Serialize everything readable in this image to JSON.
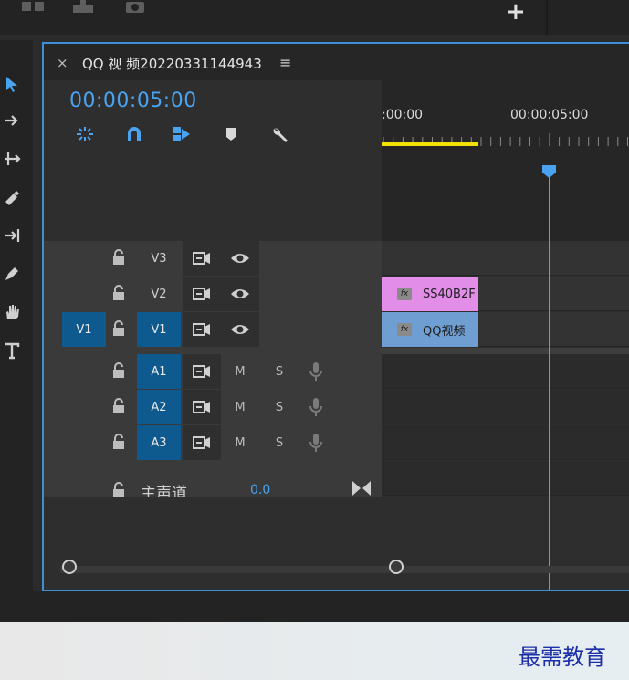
{
  "colors": {
    "accent": "#4aa3f0",
    "selected_track": "#0e5a8e",
    "panel_border": "#3f8fd6",
    "work_area": "#f0e000",
    "clip_graphic": "#e28ee8",
    "clip_video": "#6f9fd2",
    "watermark": "#1c2ea8"
  },
  "topbar": {
    "icons": [
      "grid-icon",
      "export-icon",
      "camera-icon"
    ],
    "add_label": "+"
  },
  "tools": [
    "selection-tool-icon",
    "track-select-tool-icon",
    "ripple-edit-tool-icon",
    "razor-tool-icon",
    "slip-tool-icon",
    "pen-tool-icon",
    "hand-tool-icon",
    "type-tool-icon"
  ],
  "sequence": {
    "close_label": "×",
    "title": "QQ 视 频20220331144943",
    "menu_label": "≡",
    "timecode": "00:00:05:00"
  },
  "header_tools": [
    "nest-icon",
    "snap-icon",
    "linked-selection-icon",
    "add-marker-icon",
    "settings-wrench-icon"
  ],
  "ruler": {
    "labels": [
      ":00:00",
      "00:00:05:00"
    ]
  },
  "video_tracks": [
    {
      "name": "V3",
      "targeted": false
    },
    {
      "name": "V2",
      "targeted": false
    },
    {
      "name": "V1",
      "targeted": true,
      "source": "V1"
    }
  ],
  "audio_tracks": [
    {
      "name": "A1",
      "mute": "M",
      "solo": "S"
    },
    {
      "name": "A2",
      "mute": "M",
      "solo": "S"
    },
    {
      "name": "A3",
      "mute": "M",
      "solo": "S"
    }
  ],
  "master": {
    "label": "主声道",
    "value": "0.0"
  },
  "clips": [
    {
      "track": "V2",
      "label": "SS40B2F",
      "fx": "fx"
    },
    {
      "track": "V1",
      "label": "QQ视频",
      "fx": "fx"
    }
  ],
  "watermark": "最需教育"
}
